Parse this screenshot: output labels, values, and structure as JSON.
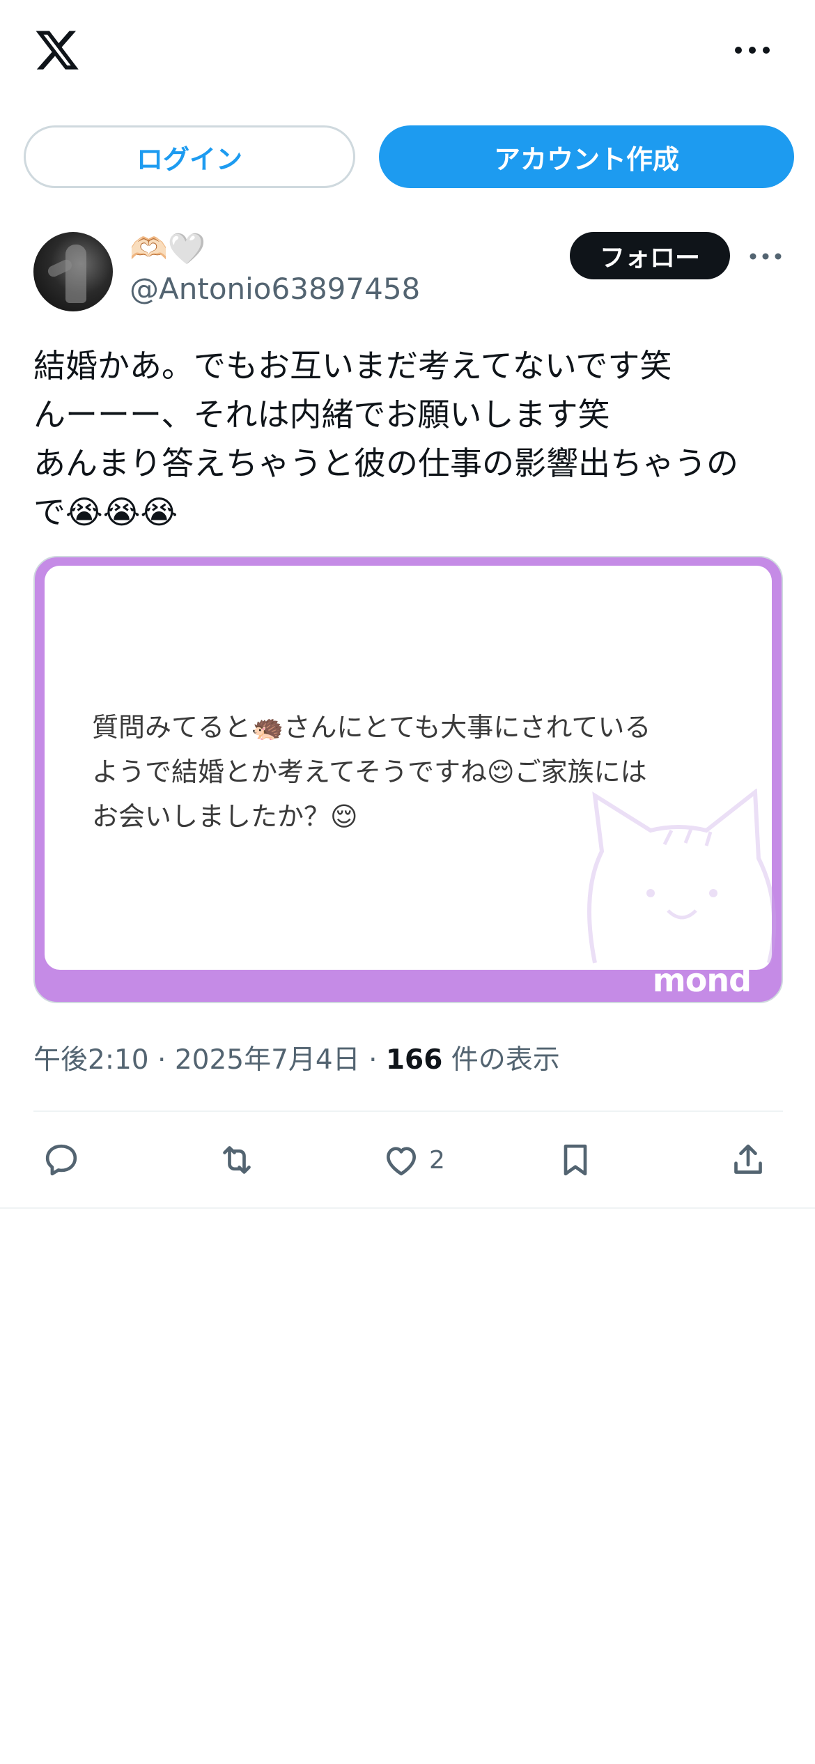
{
  "header": {
    "logo_icon": "x-logo-icon",
    "more_icon": "more-horizontal-icon"
  },
  "auth": {
    "login_label": "ログイン",
    "signup_label": "アカウント作成"
  },
  "post": {
    "display_name": "🫶🏻🤍",
    "handle": "@Antonio63897458",
    "follow_label": "フォロー",
    "text_lines": [
      "結婚かあ。でもお互いまだ考えてないです笑",
      "んーーー、それは内緒でお願いします笑",
      "あんまり答えちゃうと彼の仕事の影響出ちゃうの",
      "で😭😭😭"
    ],
    "media": {
      "lines": [
        "質問みてると🦔さんにとても大事にされている",
        "ようで結婚とか考えてそうですね😌ご家族には",
        "お会いしましたか？😌"
      ],
      "brand": "mond"
    },
    "meta": {
      "time": "午後2:10",
      "separator": "·",
      "date": "2025年7月4日",
      "views_count": "166",
      "views_label": "件の表示"
    },
    "actions": {
      "reply_icon": "reply-icon",
      "retweet_icon": "retweet-icon",
      "like_icon": "heart-icon",
      "like_count": "2",
      "bookmark_icon": "bookmark-icon",
      "share_icon": "share-icon"
    }
  },
  "colors": {
    "accent": "#1d9bf0",
    "text": "#0f1419",
    "secondary": "#536471",
    "card_frame": "#c58be6"
  }
}
